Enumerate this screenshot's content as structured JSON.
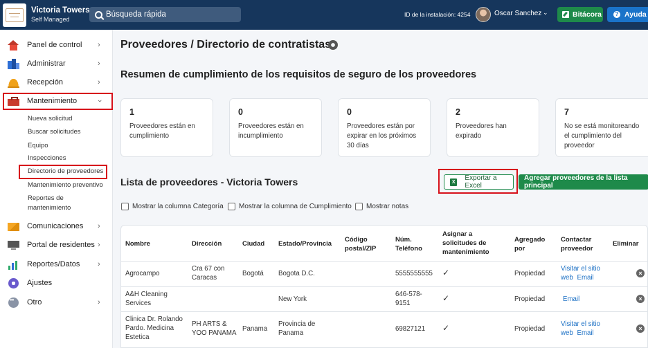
{
  "brand": {
    "name": "Victoria Towers",
    "sub": "Self Managed"
  },
  "search": {
    "placeholder": "Búsqueda rápida"
  },
  "header": {
    "install_id": "ID de la instalación: 4254",
    "user_name": "Oscar Sanchez",
    "bitacora_label": "Bitácora",
    "ayuda_label": "Ayuda"
  },
  "sidebar": {
    "items": [
      {
        "label": "Panel de control",
        "icon": "home-icon"
      },
      {
        "label": "Administrar",
        "icon": "buildings-icon"
      },
      {
        "label": "Recepción",
        "icon": "bell-icon"
      },
      {
        "label": "Mantenimiento",
        "icon": "toolbox-icon"
      },
      {
        "label": "Comunicaciones",
        "icon": "mail-icon"
      },
      {
        "label": "Portal de residentes",
        "icon": "monitor-icon"
      },
      {
        "label": "Reportes/Datos",
        "icon": "bar-chart-icon"
      },
      {
        "label": "Ajustes",
        "icon": "gear-icon"
      },
      {
        "label": "Otro",
        "icon": "more-icon"
      }
    ],
    "sub_items": [
      "Nueva solicitud",
      "Buscar solicitudes",
      "Equipo",
      "Inspecciones",
      "Directorio de proveedores",
      "Mantenimiento preventivo",
      "Reportes de",
      "mantenimiento"
    ]
  },
  "main": {
    "page_title": "Proveedores / Directorio de contratistas",
    "summary_title": "Resumen de cumplimiento de los requisitos de seguro de los proveedores",
    "cards": [
      {
        "num": "1",
        "desc": "Proveedores están en cumplimiento"
      },
      {
        "num": "0",
        "desc": "Proveedores están en incumplimiento"
      },
      {
        "num": "0",
        "desc": "Proveedores están por expirar en los próximos 30 días"
      },
      {
        "num": "2",
        "desc": "Proveedores han expirado"
      },
      {
        "num": "7",
        "desc": "No se está monitoreando el cumplimiento del proveedor"
      }
    ],
    "list_title": "Lista de proveedores - Victoria Towers",
    "export_label": "Exportar a Excel",
    "add_label": "Agregar proveedores de la lista principal",
    "checkboxes": [
      "Mostrar la columna Categoría",
      "Mostrar la columna de Cumplimiento",
      "Mostrar notas"
    ]
  },
  "table": {
    "headers": [
      "Nombre",
      "Dirección",
      "Ciudad",
      "Estado/Provincia",
      "Código postal/ZIP",
      "Núm. Teléfono",
      "Asignar a solicitudes de mantenimiento",
      "Agregado por",
      "Contactar proveedor",
      "Eliminar"
    ],
    "rows": [
      {
        "nombre": "Agrocampo",
        "direccion": "Cra 67 con Caracas",
        "ciudad": "Bogotá",
        "estado": "Bogota D.C.",
        "zip": "",
        "telefono": "5555555555",
        "asignar": "✓",
        "agregado": "Propiedad",
        "contact1": "Visitar el sitio",
        "contact2": "web",
        "contact3": "Email"
      },
      {
        "nombre": "A&H Cleaning Services",
        "direccion": "",
        "ciudad": "",
        "estado": "New York",
        "zip": "",
        "telefono": "646-578-9151",
        "asignar": "✓",
        "agregado": "Propiedad",
        "contact1": "",
        "contact2": "",
        "contact3": "Email"
      },
      {
        "nombre": "Clinica Dr. Rolando Pardo. Medicina Estetica",
        "direccion": "PH ARTS & YOO PANAMA",
        "ciudad": "Panama",
        "estado": "Provincia de Panama",
        "zip": "",
        "telefono": "69827121",
        "asignar": "✓",
        "agregado": "Propiedad",
        "contact1": "Visitar el sitio",
        "contact2": "web",
        "contact3": "Email"
      }
    ]
  }
}
